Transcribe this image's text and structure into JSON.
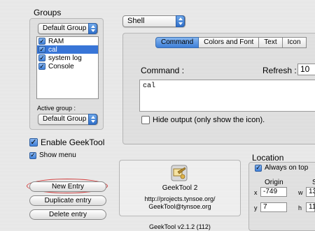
{
  "groups": {
    "title": "Groups",
    "selected_group": "Default Group",
    "items": [
      {
        "label": "RAM",
        "checked": true,
        "selected": false
      },
      {
        "label": "cal",
        "checked": true,
        "selected": true
      },
      {
        "label": "system log",
        "checked": true,
        "selected": false
      },
      {
        "label": "Console",
        "checked": true,
        "selected": false
      }
    ],
    "active_group_label": "Active group :",
    "active_group": "Default Group"
  },
  "enable": {
    "label": "Enable GeekTool",
    "checked": true
  },
  "show_menu": {
    "label": "Show menu",
    "checked": true
  },
  "buttons": {
    "new_entry": "New Entry",
    "duplicate_entry": "Duplicate entry",
    "delete_entry": "Delete entry"
  },
  "info": {
    "app_name": "GeekTool 2",
    "url": "http://projects.tynsoe.org/",
    "email": "GeekTool@tynsoe.org",
    "version": "GeekTool v2.1.2 (112)"
  },
  "entry_type": "Shell",
  "tabs": [
    "Command",
    "Colors and Font",
    "Text",
    "Icon"
  ],
  "active_tab": "Command",
  "command": {
    "label": "Command :",
    "value": "cal",
    "refresh_label": "Refresh :",
    "refresh_value": "10",
    "hide_output_label": "Hide output (only show the icon).",
    "hide_output_checked": false
  },
  "location": {
    "title": "Location",
    "always_on_top_label": "Always on top",
    "always_on_top_checked": true,
    "origin_label": "Origin",
    "size_label": "S",
    "x_label": "x",
    "x_value": "-749",
    "y_label": "y",
    "y_value": "7",
    "w_label": "w",
    "w_value": "13",
    "h_label": "h",
    "h_value": "11"
  },
  "colors": {
    "selection": "#3875d7",
    "accent": "#3d7fd9",
    "highlight_ring": "#d43a3a"
  }
}
